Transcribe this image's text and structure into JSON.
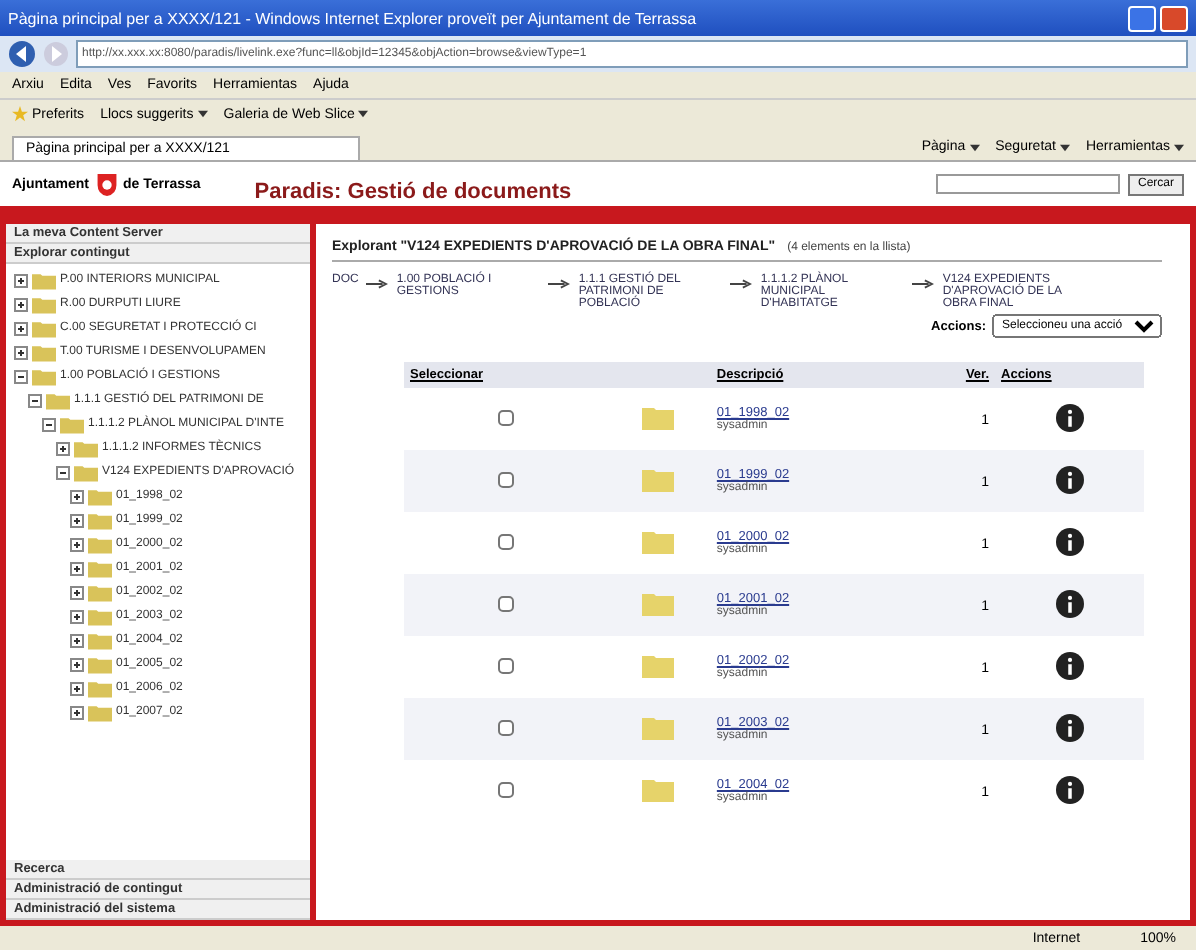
{
  "window": {
    "title": "Pàgina principal per a XXXX/121 - Windows Internet Explorer proveït per Ajuntament de Terrassa"
  },
  "address_bar": {
    "value": "http://xx.xxx.xx:8080/paradis/livelink.exe?func=ll&objId=12345&objAction=browse&viewType=1"
  },
  "menu": [
    "Arxiu",
    "Edita",
    "Ves",
    "Favorits",
    "Herramientas",
    "Ajuda"
  ],
  "favorites_bar": {
    "label": "Preferits",
    "links": [
      "Llocs suggerits",
      "Galeria de Web Slice"
    ]
  },
  "tab": {
    "title": "Pàgina principal per a XXXX/121"
  },
  "command_bar": [
    "Pàgina",
    "Seguretat",
    "Herramientas"
  ],
  "site": {
    "logo_left": "Ajuntament",
    "logo_right": "de Terrassa",
    "title": "Paradis: Gestió de documents",
    "search_button": "Cercar"
  },
  "tree": {
    "sections_top": [
      "La meva Content Server",
      "Explorar contingut"
    ],
    "items": [
      {
        "label": "P.00 INTERIORS MUNICIPAL",
        "expanded": false
      },
      {
        "label": "R.00 DURPUTI LIURE",
        "expanded": false
      },
      {
        "label": "C.00 SEGURETAT I PROTECCIÓ CI",
        "expanded": false
      },
      {
        "label": "T.00 TURISME I DESENVOLUPAMEN",
        "expanded": false
      },
      {
        "label": "1.00 POBLACIÓ I GESTIONS",
        "expanded": true,
        "children": [
          {
            "label": "1.1.1 GESTIÓ DEL PATRIMONI DE",
            "expanded": true,
            "children": [
              {
                "label": "1.1.1.2 PLÀNOL MUNICIPAL D'INTE",
                "expanded": true,
                "children": [
                  {
                    "label": "1.1.1.2 INFORMES TÈCNICS",
                    "expanded": false
                  },
                  {
                    "label": "V124 EXPEDIENTS D'APROVACIÓ",
                    "expanded": true,
                    "children": [
                      {
                        "label": "01_1998_02",
                        "expanded": false
                      },
                      {
                        "label": "01_1999_02",
                        "expanded": false
                      },
                      {
                        "label": "01_2000_02",
                        "expanded": false
                      },
                      {
                        "label": "01_2001_02",
                        "expanded": false
                      },
                      {
                        "label": "01_2002_02",
                        "expanded": false
                      },
                      {
                        "label": "01_2003_02",
                        "expanded": false
                      },
                      {
                        "label": "01_2004_02",
                        "expanded": false
                      },
                      {
                        "label": "01_2005_02",
                        "expanded": false
                      },
                      {
                        "label": "01_2006_02",
                        "expanded": false
                      },
                      {
                        "label": "01_2007_02",
                        "expanded": false
                      }
                    ]
                  }
                ]
              }
            ]
          }
        ]
      }
    ],
    "sections_bottom": [
      "Recerca",
      "Administració de contingut",
      "Administració del sistema"
    ]
  },
  "main": {
    "heading": "Explorant \"V124 EXPEDIENTS D'APROVACIÓ DE LA OBRA FINAL\"",
    "count": "(4 elements en la llista)",
    "breadcrumb": [
      "DOC",
      "1.00 POBLACIÓ I GESTIONS",
      "1.1.1 GESTIÓ DEL PATRIMONI DE POBLACIÓ",
      "1.1.1.2 PLÀNOL MUNICIPAL D'HABITATGE",
      "V124 EXPEDIENTS D'APROVACIÓ DE LA OBRA FINAL"
    ],
    "actions_label": "Accions:",
    "actions_select": "Seleccioneu una acció",
    "columns": [
      "Seleccionar",
      "Descripció",
      "Ver.",
      "Accions"
    ],
    "rows": [
      {
        "name": "01_1998_02",
        "owner": "sysadmin",
        "version": "1",
        "checked": false
      },
      {
        "name": "01_1999_02",
        "owner": "sysadmin",
        "version": "1",
        "checked": false
      },
      {
        "name": "01_2000_02",
        "owner": "sysadmin",
        "version": "1",
        "checked": false
      },
      {
        "name": "01_2001_02",
        "owner": "sysadmin",
        "version": "1",
        "checked": false
      },
      {
        "name": "01_2002_02",
        "owner": "sysadmin",
        "version": "1",
        "checked": false
      },
      {
        "name": "01_2003_02",
        "owner": "sysadmin",
        "version": "1",
        "checked": false
      },
      {
        "name": "01_2004_02",
        "owner": "sysadmin",
        "version": "1",
        "checked": false
      }
    ]
  },
  "status_bar": {
    "zone": "Internet",
    "zoom": "100%"
  }
}
